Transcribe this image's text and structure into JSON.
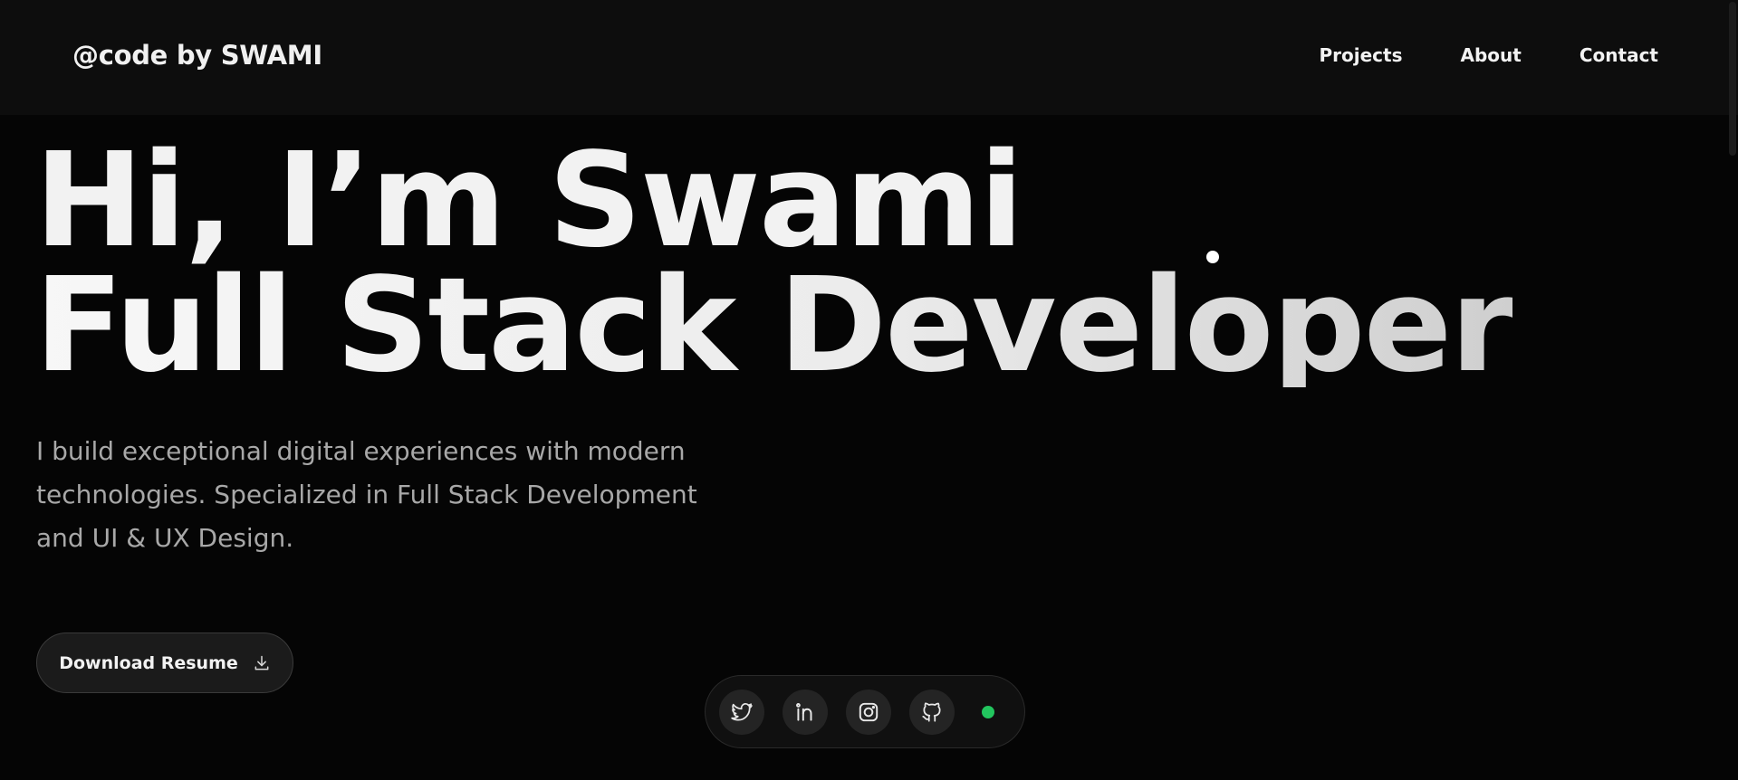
{
  "brand": {
    "text": "@code by SWAMI"
  },
  "nav": {
    "items": [
      {
        "label": "Projects"
      },
      {
        "label": "About"
      },
      {
        "label": "Contact"
      }
    ]
  },
  "hero": {
    "headline_line1": "Hi, I’m Swami",
    "headline_line2": "Full Stack Developer",
    "intro": "I build exceptional digital experiences with modern technologies. Specialized in Full Stack Development and UI & UX Design."
  },
  "cta": {
    "label": "Download Resume",
    "icon": "download-icon"
  },
  "socials": [
    {
      "icon": "twitter-icon"
    },
    {
      "icon": "linkedin-icon"
    },
    {
      "icon": "instagram-icon"
    },
    {
      "icon": "github-icon"
    }
  ],
  "status": {
    "color": "#22c55e"
  },
  "colors": {
    "background": "#050505",
    "navbar": "#0d0d0d",
    "text": "#f2f2f2",
    "muted_text": "#a8a8a8",
    "button_bg": "#1b1b1b"
  }
}
